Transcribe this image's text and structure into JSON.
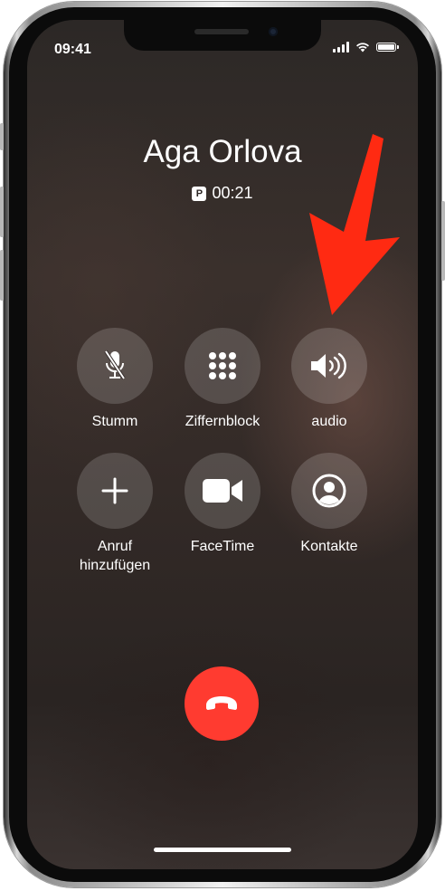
{
  "status_bar": {
    "time": "09:41",
    "icons": [
      "signal-icon",
      "wifi-icon",
      "battery-icon"
    ]
  },
  "call": {
    "caller_name": "Aga Orlova",
    "badge": "P",
    "duration": "00:21"
  },
  "controls": [
    {
      "label": "Stumm",
      "icon": "mute-icon"
    },
    {
      "label": "Ziffernblock",
      "icon": "keypad-icon"
    },
    {
      "label": "audio",
      "icon": "speaker-icon"
    },
    {
      "label": "Anruf\nhinzufügen",
      "icon": "plus-icon"
    },
    {
      "label": "FaceTime",
      "icon": "video-camera-icon"
    },
    {
      "label": "Kontakte",
      "icon": "contact-icon"
    }
  ],
  "end_call": {
    "icon": "end-call-icon",
    "color": "#ff3b30"
  },
  "annotation": {
    "type": "arrow",
    "color": "#ff2a12",
    "points_to": "audio"
  }
}
